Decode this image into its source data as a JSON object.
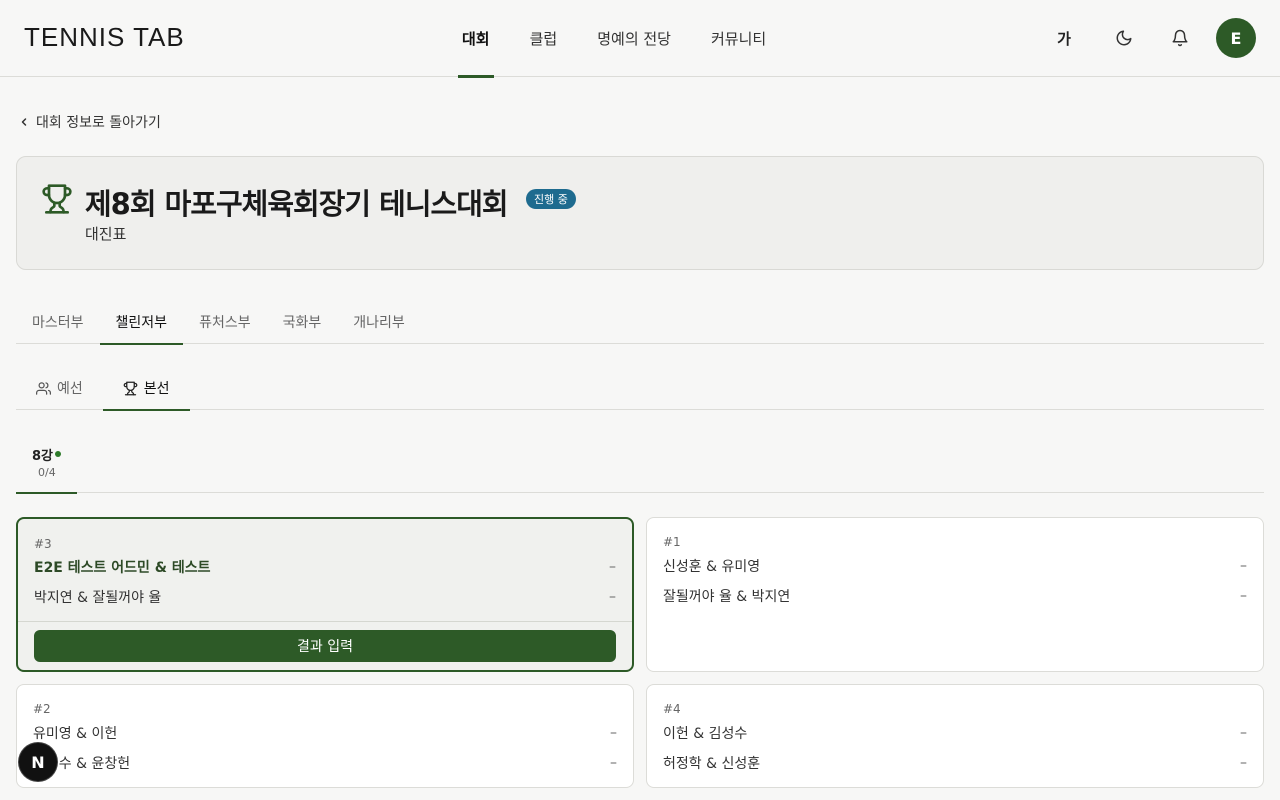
{
  "header": {
    "logo": "TENNIS TAB",
    "nav": [
      {
        "label": "대회",
        "active": true
      },
      {
        "label": "클럽",
        "active": false
      },
      {
        "label": "명예의 전당",
        "active": false
      },
      {
        "label": "커뮤니티",
        "active": false
      }
    ],
    "font_toggle": "가",
    "avatar_initial": "E"
  },
  "back_link": "대회 정보로 돌아가기",
  "tournament": {
    "title": "제8회 마포구체육회장기 테니스대회",
    "status": "진행 중",
    "subtitle": "대진표"
  },
  "division_tabs": [
    {
      "label": "마스터부",
      "active": false
    },
    {
      "label": "챌린저부",
      "active": true
    },
    {
      "label": "퓨처스부",
      "active": false
    },
    {
      "label": "국화부",
      "active": false
    },
    {
      "label": "개나리부",
      "active": false
    }
  ],
  "stage_tabs": [
    {
      "label": "예선",
      "active": false
    },
    {
      "label": "본선",
      "active": true
    }
  ],
  "round": {
    "name": "8강",
    "count": "0/4"
  },
  "matches": [
    {
      "number": "#3",
      "team1": "E2E 테스트 어드민 & 테스트",
      "score1": "–",
      "team2": "박지연 & 잘될꺼야 율",
      "score2": "–",
      "action": "결과 입력"
    },
    {
      "number": "#1",
      "team1": "신성훈 & 유미영",
      "score1": "–",
      "team2": "잘될꺼야 율 & 박지연",
      "score2": "–"
    },
    {
      "number": "#2",
      "team1": "유미영 & 이헌",
      "score1": "–",
      "team2": "김성수 & 윤창헌",
      "score2": "–"
    },
    {
      "number": "#4",
      "team1": "이헌 & 김성수",
      "score1": "–",
      "team2": "허정학 & 신성훈",
      "score2": "–"
    }
  ],
  "fab_label": "N",
  "colors": {
    "accent": "#2d5a27",
    "badge": "#1e6b8f"
  }
}
